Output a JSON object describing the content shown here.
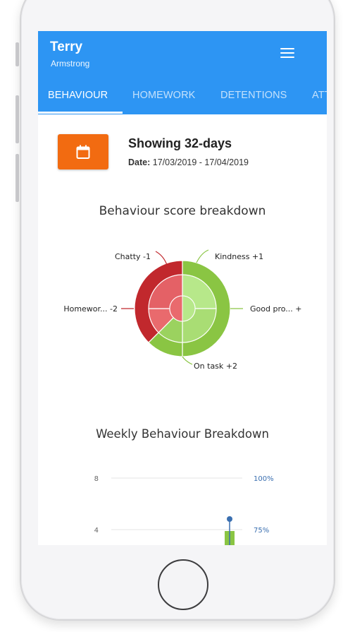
{
  "app": {
    "user_first": "Terry",
    "user_last": "Armstrong",
    "menu_icon": "hamburger-menu-icon"
  },
  "tabs": [
    {
      "label": "BEHAVIOUR",
      "active": true
    },
    {
      "label": "HOMEWORK",
      "active": false
    },
    {
      "label": "DETENTIONS",
      "active": false
    },
    {
      "label": "ATT",
      "active": false
    }
  ],
  "date_range": {
    "icon": "calendar-icon",
    "showing": "Showing 32-days",
    "date_label": "Date:",
    "date_value": "17/03/2019 - 17/04/2019"
  },
  "colors": {
    "brand": "#2d95f3",
    "accent": "#f26b11",
    "positive": "#8ac543",
    "negative": "#c1282d"
  },
  "chart_data": [
    {
      "type": "pie",
      "title": "Behaviour score breakdown",
      "labels": [
        "Kindness +1",
        "Good pro... +",
        "On task +2",
        "Homewor... -2",
        "Chatty -1"
      ],
      "values": [
        1,
        2,
        2,
        2,
        1
      ],
      "polarity": [
        "positive",
        "positive",
        "positive",
        "negative",
        "negative"
      ]
    },
    {
      "type": "bar",
      "title": "Weekly Behaviour Breakdown",
      "y_ticks": [
        "8",
        "4"
      ],
      "y2_ticks": [
        "100%",
        "75%"
      ]
    }
  ]
}
